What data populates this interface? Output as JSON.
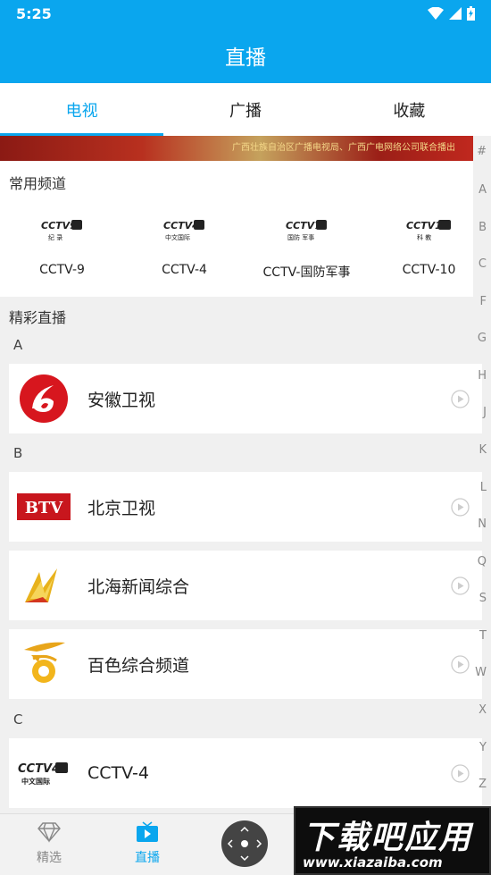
{
  "status_bar": {
    "time": "5:25"
  },
  "header": {
    "title": "直播"
  },
  "tabs": [
    {
      "label": "电视",
      "active": true
    },
    {
      "label": "广播",
      "active": false
    },
    {
      "label": "收藏",
      "active": false
    }
  ],
  "banner": {
    "text": "广西壮族自治区广播电视局、广西广电网络公司联合播出"
  },
  "common_channels": {
    "title": "常用频道",
    "items": [
      {
        "name": "CCTV-9",
        "logo_text": "CCTV9",
        "logo_sub": "纪 录"
      },
      {
        "name": "CCTV-4",
        "logo_text": "CCTV4",
        "logo_sub": "中文国际"
      },
      {
        "name": "CCTV-国防军事",
        "logo_text": "CCTV7",
        "logo_sub": "国防 军事"
      },
      {
        "name": "CCTV-10",
        "logo_text": "CCTV10",
        "logo_sub": "科 教"
      }
    ]
  },
  "live": {
    "title": "精彩直播",
    "groups": [
      {
        "letter": "A",
        "items": [
          {
            "name": "安徽卫视",
            "logo": "anhui"
          }
        ]
      },
      {
        "letter": "B",
        "items": [
          {
            "name": "北京卫视",
            "logo": "btv",
            "logo_text": "BTV"
          },
          {
            "name": "北海新闻综合",
            "logo": "beihai"
          },
          {
            "name": "百色综合频道",
            "logo": "baise"
          }
        ]
      },
      {
        "letter": "C",
        "items": [
          {
            "name": "CCTV-4",
            "logo": "cctv4",
            "logo_text": "CCTV4",
            "logo_sub": "中文国际"
          }
        ]
      }
    ]
  },
  "index_letters": [
    "#",
    "A",
    "B",
    "C",
    "F",
    "G",
    "H",
    "J",
    "K",
    "L",
    "N",
    "Q",
    "S",
    "T",
    "W",
    "X",
    "Y",
    "Z"
  ],
  "bottom_nav": [
    {
      "label": "精选",
      "icon": "diamond-icon",
      "active": false
    },
    {
      "label": "直播",
      "icon": "tv-icon",
      "active": true
    }
  ],
  "watermark": {
    "title": "下载吧应用",
    "url": "www.xiazaiba.com"
  },
  "colors": {
    "accent": "#0aa6ee"
  }
}
